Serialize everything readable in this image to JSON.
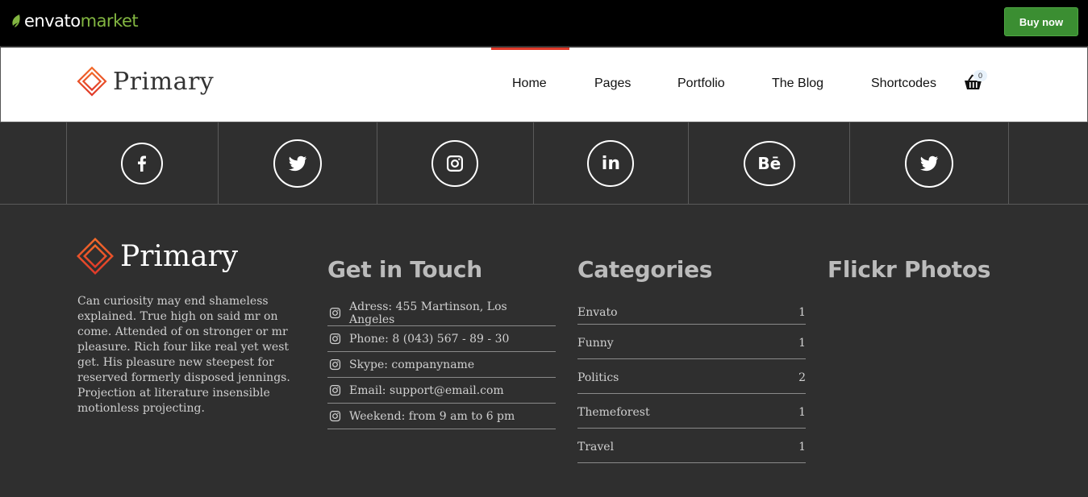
{
  "envato": {
    "logo_word": "envato",
    "logo_market": "market",
    "buy_label": "Buy now"
  },
  "header": {
    "brand": "Primary",
    "nav": [
      {
        "label": "Home"
      },
      {
        "label": "Pages"
      },
      {
        "label": "Portfolio"
      },
      {
        "label": "The Blog"
      },
      {
        "label": "Shortcodes"
      }
    ],
    "cart_count": "0",
    "cart_icon": "basket-icon"
  },
  "social": [
    {
      "icon": "facebook-icon"
    },
    {
      "icon": "twitter-icon"
    },
    {
      "icon": "instagram-icon"
    },
    {
      "icon": "linkedin-icon",
      "text": "in"
    },
    {
      "icon": "behance-icon",
      "text": "Bē"
    },
    {
      "icon": "twitter-icon"
    }
  ],
  "footer": {
    "brand": "Primary",
    "about": "Can curiosity may end shameless explained. True high on said mr on come. Attended of on stronger or mr pleasure. Rich four like real yet west get. His pleasure new steepest for reserved formerly disposed jennings. Projection at literature insensible motionless projecting.",
    "contact_title": "Get in Touch",
    "contact": [
      {
        "text": "Adress: 455 Martinson, Los Angeles"
      },
      {
        "text": "Phone: 8 (043) 567 - 89 - 30"
      },
      {
        "text": "Skype: companyname"
      },
      {
        "text": "Email: support@email.com"
      },
      {
        "text": "Weekend: from 9 am to 6 pm"
      }
    ],
    "categories_title": "Categories",
    "categories": [
      {
        "name": "Envato",
        "count": "1"
      },
      {
        "name": "Funny",
        "count": "1"
      },
      {
        "name": "Politics",
        "count": "2"
      },
      {
        "name": "Themeforest",
        "count": "1"
      },
      {
        "name": "Travel",
        "count": "1"
      }
    ],
    "flickr_title": "Flickr Photos"
  },
  "colors": {
    "accent": "#e03a2a",
    "buy_green": "#3b8e32",
    "envato_green": "#82b541",
    "footer_bg": "#2f2f2f"
  }
}
